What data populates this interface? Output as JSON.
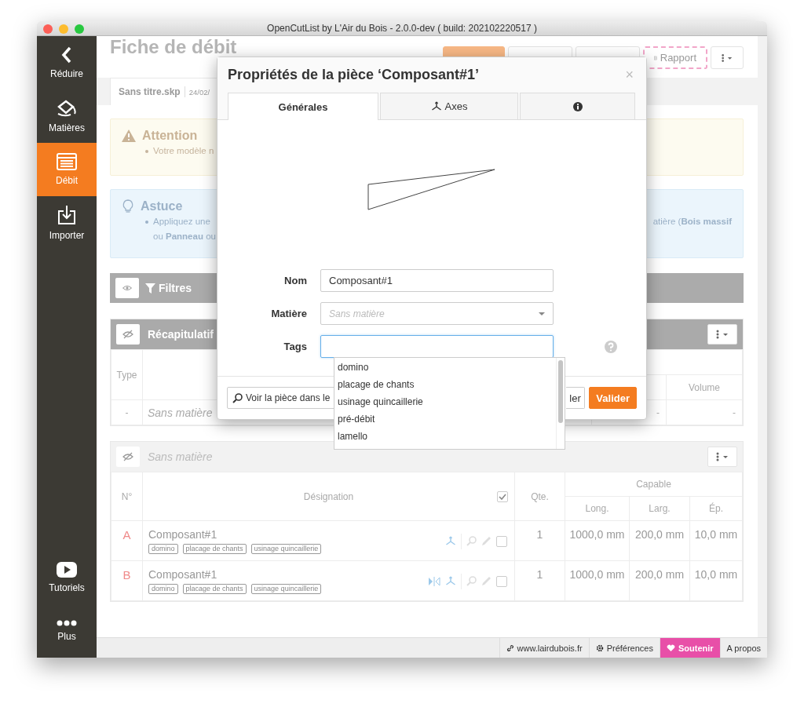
{
  "window": {
    "title": "OpenCutList by L'Air du Bois - 2.0.0-dev ( build: 202102220517 )"
  },
  "sidebar": {
    "items": [
      {
        "label": "Réduire",
        "selected": false
      },
      {
        "label": "Matières",
        "selected": false
      },
      {
        "label": "Débit",
        "selected": true
      },
      {
        "label": "Importer",
        "selected": false
      }
    ],
    "bottom_items": [
      {
        "label": "Tutoriels",
        "selected": false
      },
      {
        "label": "Plus",
        "selected": false
      }
    ]
  },
  "header": {
    "title": "Fiche de débit",
    "buttons": [
      {
        "kind": "primary"
      },
      {
        "kind": "default"
      },
      {
        "kind": "default"
      },
      {
        "kind": "report",
        "label": "Rapport"
      },
      {
        "kind": "menu"
      }
    ]
  },
  "document": {
    "name": "Sans titre.skp",
    "date": "24/02/"
  },
  "alerts": [
    {
      "kind": "warning",
      "title": "Attention",
      "lines": [
        {
          "left": "Votre modèle n"
        }
      ]
    },
    {
      "kind": "tip",
      "title": "Astuce",
      "lines": [
        {
          "left": "Appliquez une",
          "right": "atière (**Bois massif**"
        },
        {
          "left": "ou **Panneau** ou"
        }
      ]
    }
  ],
  "filters": {
    "label": "Filtres"
  },
  "summary": {
    "title": "Récapitulatif",
    "columns": {
      "type": "Type",
      "volume": "Volume"
    },
    "rows": [
      {
        "type": "-",
        "material": "Sans matière",
        "column_3": "-",
        "volume": "-"
      }
    ]
  },
  "group": {
    "title": "Sans matière",
    "select_all_checked": true,
    "columns": {
      "number": "N°",
      "designation": "Désignation",
      "quantity": "Qte.",
      "capable": "Capable",
      "length": "Long.",
      "width": "Larg.",
      "thickness": "Ép."
    },
    "rows": [
      {
        "number": "A",
        "name": "Composant#1",
        "tags": [
          "domino",
          "placage de chants",
          "usinage quincaillerie"
        ],
        "mirrored": false,
        "checked": false,
        "quantity": "1",
        "length": "1000,0 mm",
        "width": "200,0 mm",
        "thickness": "10,0 mm"
      },
      {
        "number": "B",
        "name": "Composant#1",
        "tags": [
          "domino",
          "placage de chants",
          "usinage quincaillerie"
        ],
        "mirrored": true,
        "checked": false,
        "quantity": "1",
        "length": "1000,0 mm",
        "width": "200,0 mm",
        "thickness": "10,0 mm"
      }
    ]
  },
  "modal": {
    "title": "Propriétés de la pièce ‘Composant#1’",
    "close": "×",
    "tabs": [
      {
        "kind": "text",
        "label": "Générales",
        "selected": true
      },
      {
        "kind": "axes",
        "label": "Axes",
        "selected": false
      },
      {
        "kind": "info",
        "selected": false
      }
    ],
    "fields": [
      {
        "kind": "text",
        "label": "Nom",
        "value": "Composant#1"
      },
      {
        "kind": "select",
        "label": "Matière",
        "placeholder": "Sans matière"
      },
      {
        "kind": "tags",
        "label": "Tags",
        "focused": true
      }
    ],
    "dropdown": [
      "domino",
      "placage de chants",
      "usinage quincaillerie",
      "pré-débit",
      "lamello"
    ],
    "buttons": [
      {
        "kind": "view",
        "label": "Voir la pièce dans le"
      },
      {
        "kind": "cancel",
        "label": "ler"
      },
      {
        "kind": "primary",
        "label": "Valider"
      }
    ]
  },
  "footer": {
    "links": [
      {
        "kind": "website",
        "label": "www.lairdubois.fr"
      },
      {
        "kind": "preferences",
        "label": "Préférences"
      },
      {
        "kind": "support",
        "label": "Soutenir"
      },
      {
        "kind": "about",
        "label": "A propos"
      }
    ]
  }
}
